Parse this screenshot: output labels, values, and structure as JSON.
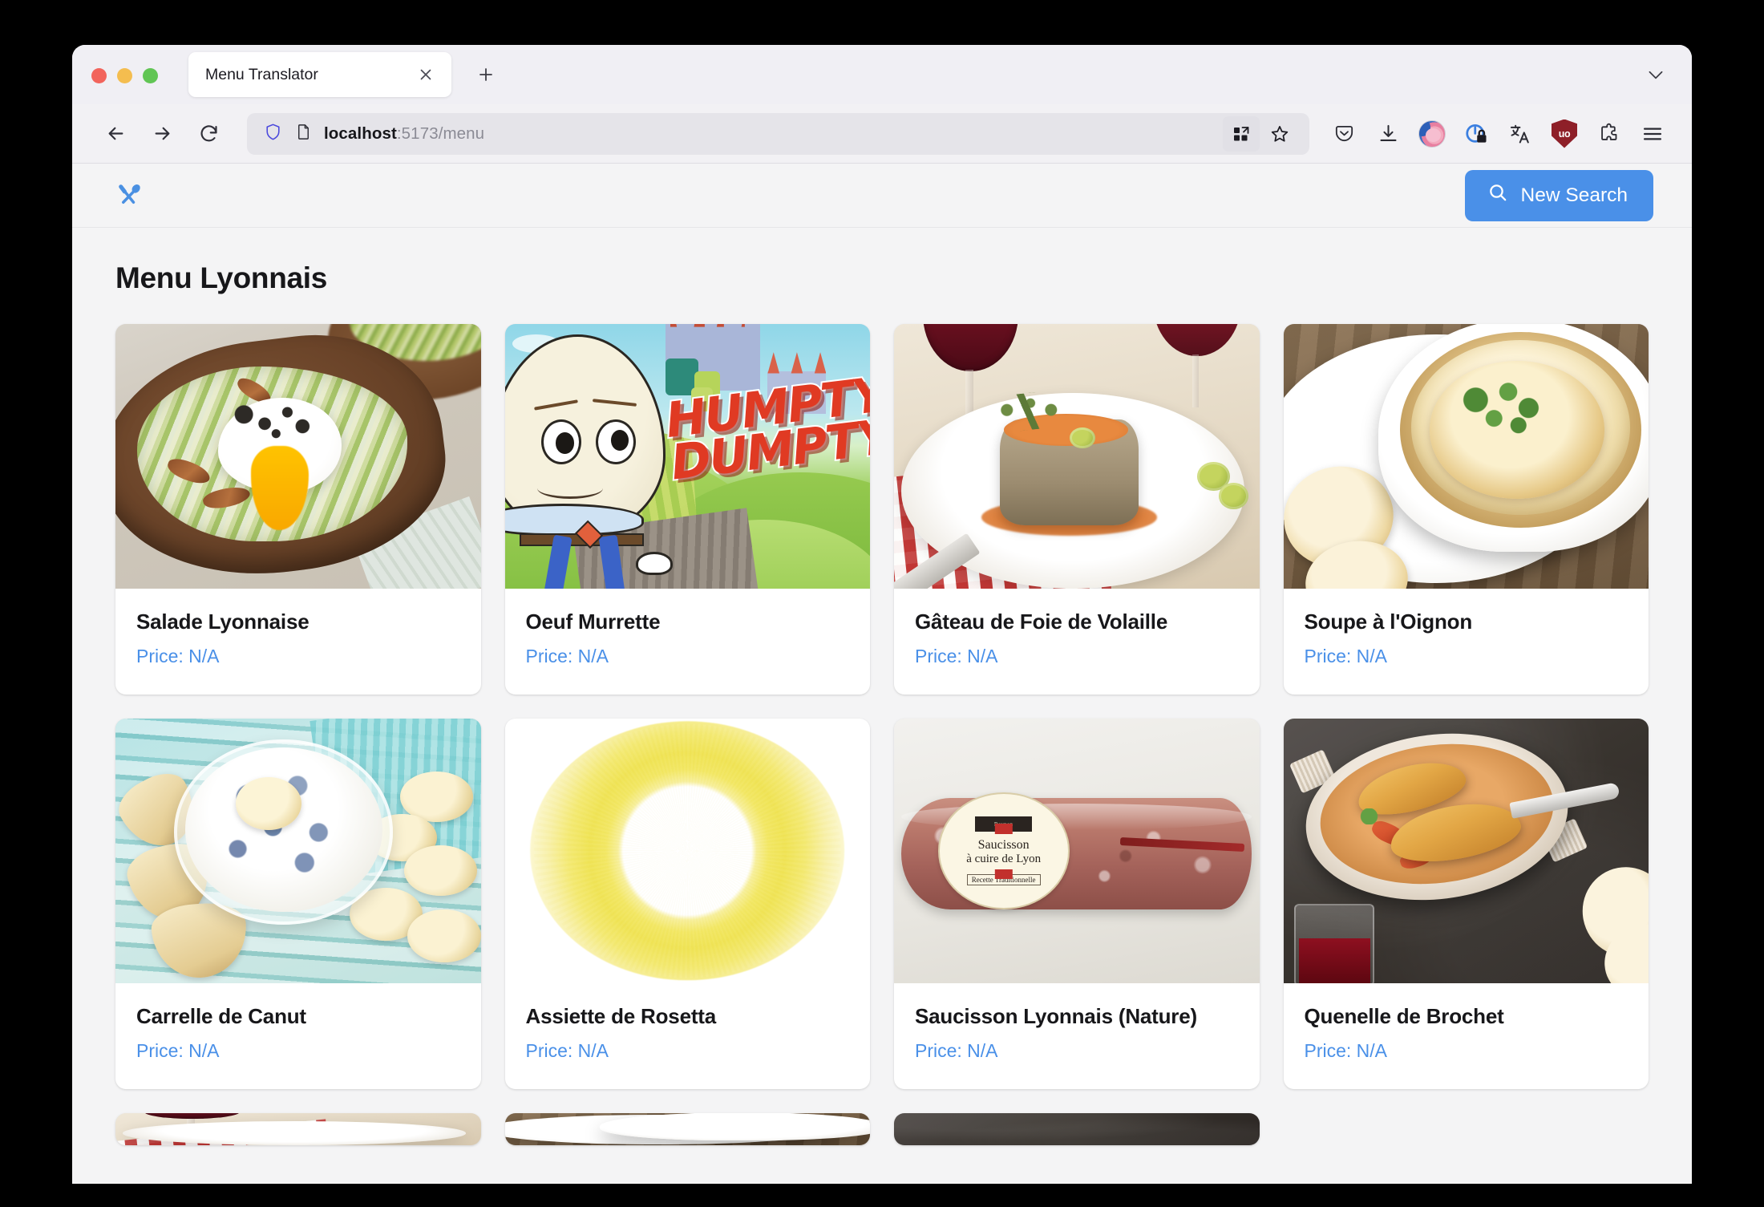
{
  "browser": {
    "window_controls": [
      "close",
      "minimize",
      "maximize"
    ],
    "tab": {
      "title": "Menu Translator",
      "close_label": "×"
    },
    "new_tab_label": "+",
    "tab_list_chevron": "⌄",
    "nav": {
      "back": "←",
      "forward": "→",
      "reload": "↻"
    },
    "url": {
      "host": "localhost",
      "rest": ":5173/menu",
      "shield_icon": "shield-icon",
      "page_icon": "page-icon"
    },
    "toolbar_icons": [
      "grid-expand-icon",
      "bookmark-star-icon",
      "pocket-icon",
      "download-icon",
      "account-avatar-icon",
      "privacy-lock-icon",
      "translate-icon",
      "ublock-origin-icon",
      "extensions-puzzle-icon",
      "app-menu-icon"
    ]
  },
  "app": {
    "logo_icon": "fork-and-spoon-icon",
    "new_search_button": "New Search",
    "search_icon": "search-icon",
    "page_title": "Menu Lyonnais",
    "accent_color": "#4a90e8",
    "price_color": "#4a90e8"
  },
  "menu": {
    "price_prefix": "Price:",
    "items": [
      {
        "name": "Salade Lyonnaise",
        "price": "Price: N/A",
        "image": "frisee-salad-with-poached-egg-on-wooden-plate"
      },
      {
        "name": "Oeuf Murrette",
        "price": "Price: N/A",
        "image": "humpty-dumpty-cartoon-illustration",
        "image_text_line1": "HUMPTY",
        "image_text_line2": "DUMPTY"
      },
      {
        "name": "Gâteau de Foie de Volaille",
        "price": "Price: N/A",
        "image": "chicken-liver-cake-with-tomato-sauce-and-olives"
      },
      {
        "name": "Soupe à l'Oignon",
        "price": "Price: N/A",
        "image": "french-onion-soup-crock-with-cheese-crouton"
      },
      {
        "name": "Carrelle de Canut",
        "price": "Price: N/A",
        "image": "cheese-dip-bowl-with-bread-and-crackers"
      },
      {
        "name": "Assiette de Rosetta",
        "price": "Price: N/A",
        "image": "yellow-ring-torus-on-white"
      },
      {
        "name": "Saucisson Lyonnais (Nature)",
        "price": "Price: N/A",
        "image": "packaged-lyon-cooking-sausage",
        "label_brand": "Reynon",
        "label_line1": "Saucisson",
        "label_line2": "à cuire de Lyon",
        "label_line3": "Recette Traditionnelle"
      },
      {
        "name": "Quenelle de Brochet",
        "price": "Price: N/A",
        "image": "pike-quenelles-in-gratin-dish-with-crayfish-sauce"
      }
    ]
  }
}
